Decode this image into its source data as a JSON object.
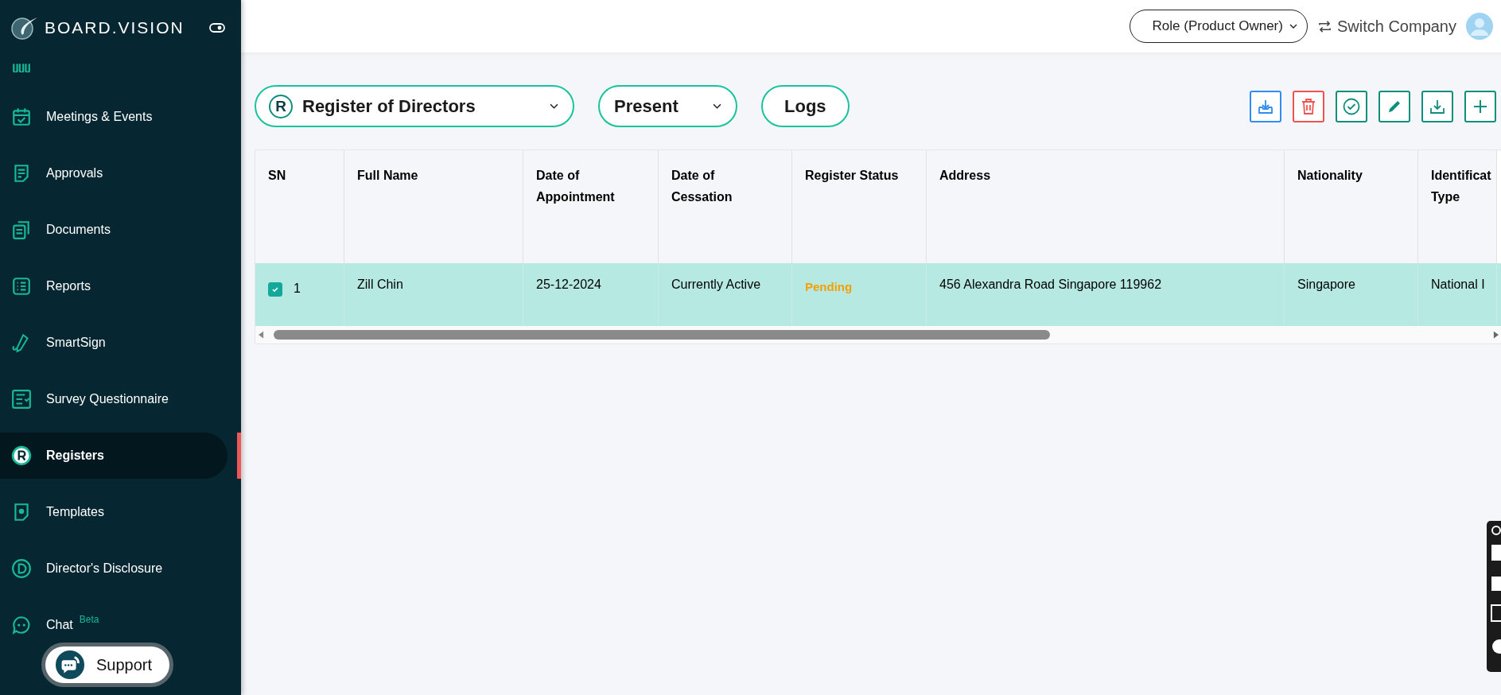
{
  "brand": {
    "name": "BOARD.VISION"
  },
  "sidebar": {
    "items": [
      {
        "kind": "planning",
        "selected": false
      },
      {
        "label": "Meetings & Events",
        "kind": "calendar",
        "selected": false
      },
      {
        "label": "Approvals",
        "kind": "note",
        "selected": false
      },
      {
        "label": "Documents",
        "kind": "docs",
        "selected": false
      },
      {
        "label": "Reports",
        "kind": "list",
        "selected": false
      },
      {
        "label": "SmartSign",
        "kind": "pen",
        "selected": false
      },
      {
        "label": "Survey Questionnaire",
        "kind": "survey",
        "selected": false
      },
      {
        "label": "Registers",
        "kind": "r",
        "selected": true
      },
      {
        "label": "Templates",
        "kind": "template",
        "selected": false
      },
      {
        "label": "Director's Disclosure",
        "kind": "d",
        "selected": false
      },
      {
        "label": "Chat",
        "kind": "chat",
        "selected": false,
        "badge": "Beta"
      }
    ]
  },
  "support": {
    "label": "Support"
  },
  "header": {
    "role": "Role (Product Owner)",
    "switch": "Switch Company"
  },
  "toolbar": {
    "register": "Register of Directors",
    "register_letter": "R",
    "period": "Present",
    "logs": "Logs",
    "actions": [
      {
        "kind": "import"
      },
      {
        "kind": "delete"
      },
      {
        "kind": "approve"
      },
      {
        "kind": "edit"
      },
      {
        "kind": "download"
      },
      {
        "kind": "add"
      }
    ]
  },
  "table": {
    "columns": [
      "SN",
      "Full Name",
      "Date of Appointment",
      "Date of Cessation",
      "Register Status",
      "Address",
      "Nationality",
      "Identificat Type"
    ],
    "rows": [
      {
        "checked": true,
        "selected": true,
        "cells": [
          "1",
          "Zill Chin",
          "25-12-2024",
          "Currently Active",
          "Pending",
          "456 Alexandra Road Singapore 119962",
          "Singapore",
          "National I"
        ]
      }
    ]
  }
}
